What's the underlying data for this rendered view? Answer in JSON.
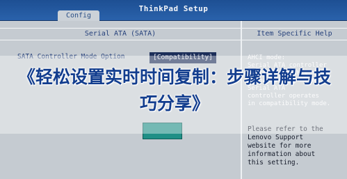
{
  "app": {
    "title": "ThinkPad Setup",
    "active_tab": "Config"
  },
  "main_panel": {
    "header": "Serial ATA (SATA)",
    "setting": {
      "label": "SATA Controller Mode Option",
      "value": "[Compatibility]"
    }
  },
  "help_panel": {
    "header": "Item Specific Help",
    "text_top": "AHCI mode:\nSerial ATA controller\noperates in AHCI mode.\nCompatibility mode:\nSerial ATA\ncontroller operates\nin compatibility mode.",
    "text_bottom": "Please refer to the\nLenovo Support\nwebsite for more\ninformation about\nthis setting."
  },
  "overlay": {
    "headline": "《轻松设置实时时间复制：步骤详解与技巧分享》"
  },
  "colors": {
    "topbar": "#1d4f93",
    "panel_bg": "#c5cbd1",
    "text_blue": "#25407a",
    "headline": "#123d8e"
  }
}
